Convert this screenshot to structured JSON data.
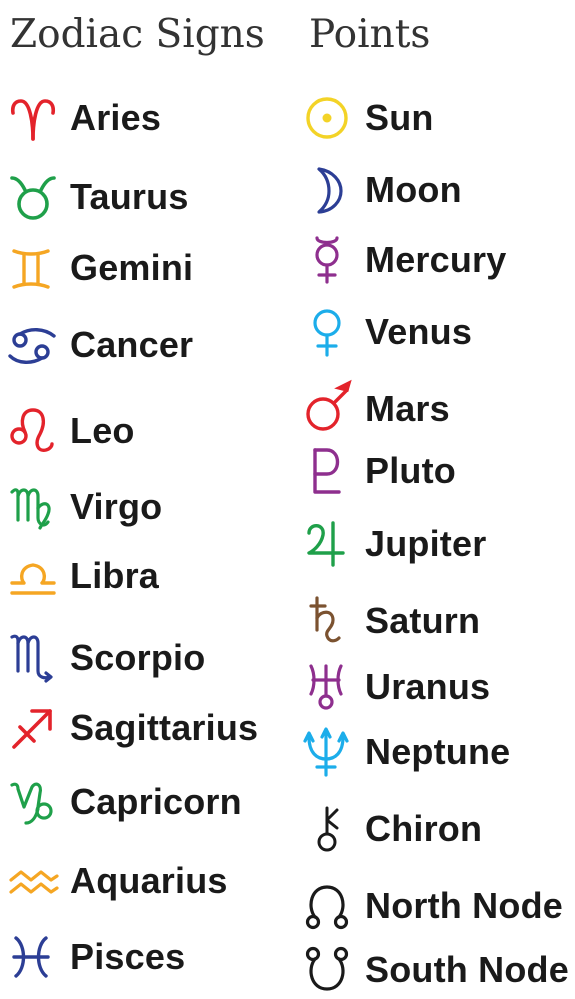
{
  "headers": {
    "signs": "Zodiac Signs",
    "points": "Points"
  },
  "signs": [
    {
      "label": "Aries",
      "icon": "aries-glyph",
      "color": "#e3232b"
    },
    {
      "label": "Taurus",
      "icon": "taurus-glyph",
      "color": "#1fa04a"
    },
    {
      "label": "Gemini",
      "icon": "gemini-glyph",
      "color": "#f5a623"
    },
    {
      "label": "Cancer",
      "icon": "cancer-glyph",
      "color": "#2c3e95"
    },
    {
      "label": "Leo",
      "icon": "leo-glyph",
      "color": "#e3232b"
    },
    {
      "label": "Virgo",
      "icon": "virgo-glyph",
      "color": "#1fa04a"
    },
    {
      "label": "Libra",
      "icon": "libra-glyph",
      "color": "#f5a623"
    },
    {
      "label": "Scorpio",
      "icon": "scorpio-glyph",
      "color": "#2c3e95"
    },
    {
      "label": "Sagittarius",
      "icon": "sagittarius-glyph",
      "color": "#e3232b"
    },
    {
      "label": "Capricorn",
      "icon": "capricorn-glyph",
      "color": "#1fa04a"
    },
    {
      "label": "Aquarius",
      "icon": "aquarius-glyph",
      "color": "#f5a623"
    },
    {
      "label": "Pisces",
      "icon": "pisces-glyph",
      "color": "#2c3e95"
    }
  ],
  "points": [
    {
      "label": "Sun",
      "icon": "sun-glyph",
      "color": "#f3d327"
    },
    {
      "label": "Moon",
      "icon": "moon-glyph",
      "color": "#2c3e95"
    },
    {
      "label": "Mercury",
      "icon": "mercury-glyph",
      "color": "#8e2f8e"
    },
    {
      "label": "Venus",
      "icon": "venus-glyph",
      "color": "#1cadea"
    },
    {
      "label": "Mars",
      "icon": "mars-glyph",
      "color": "#e3232b"
    },
    {
      "label": "Pluto",
      "icon": "pluto-glyph",
      "color": "#8e2f8e"
    },
    {
      "label": "Jupiter",
      "icon": "jupiter-glyph",
      "color": "#1fa04a"
    },
    {
      "label": "Saturn",
      "icon": "saturn-glyph",
      "color": "#7b5230"
    },
    {
      "label": "Uranus",
      "icon": "uranus-glyph",
      "color": "#8e2f8e"
    },
    {
      "label": "Neptune",
      "icon": "neptune-glyph",
      "color": "#1cadea"
    },
    {
      "label": "Chiron",
      "icon": "chiron-glyph",
      "color": "#1a1a1a"
    },
    {
      "label": "North Node",
      "icon": "north-node-glyph",
      "color": "#1a1a1a"
    },
    {
      "label": "South Node",
      "icon": "south-node-glyph",
      "color": "#1a1a1a"
    }
  ]
}
